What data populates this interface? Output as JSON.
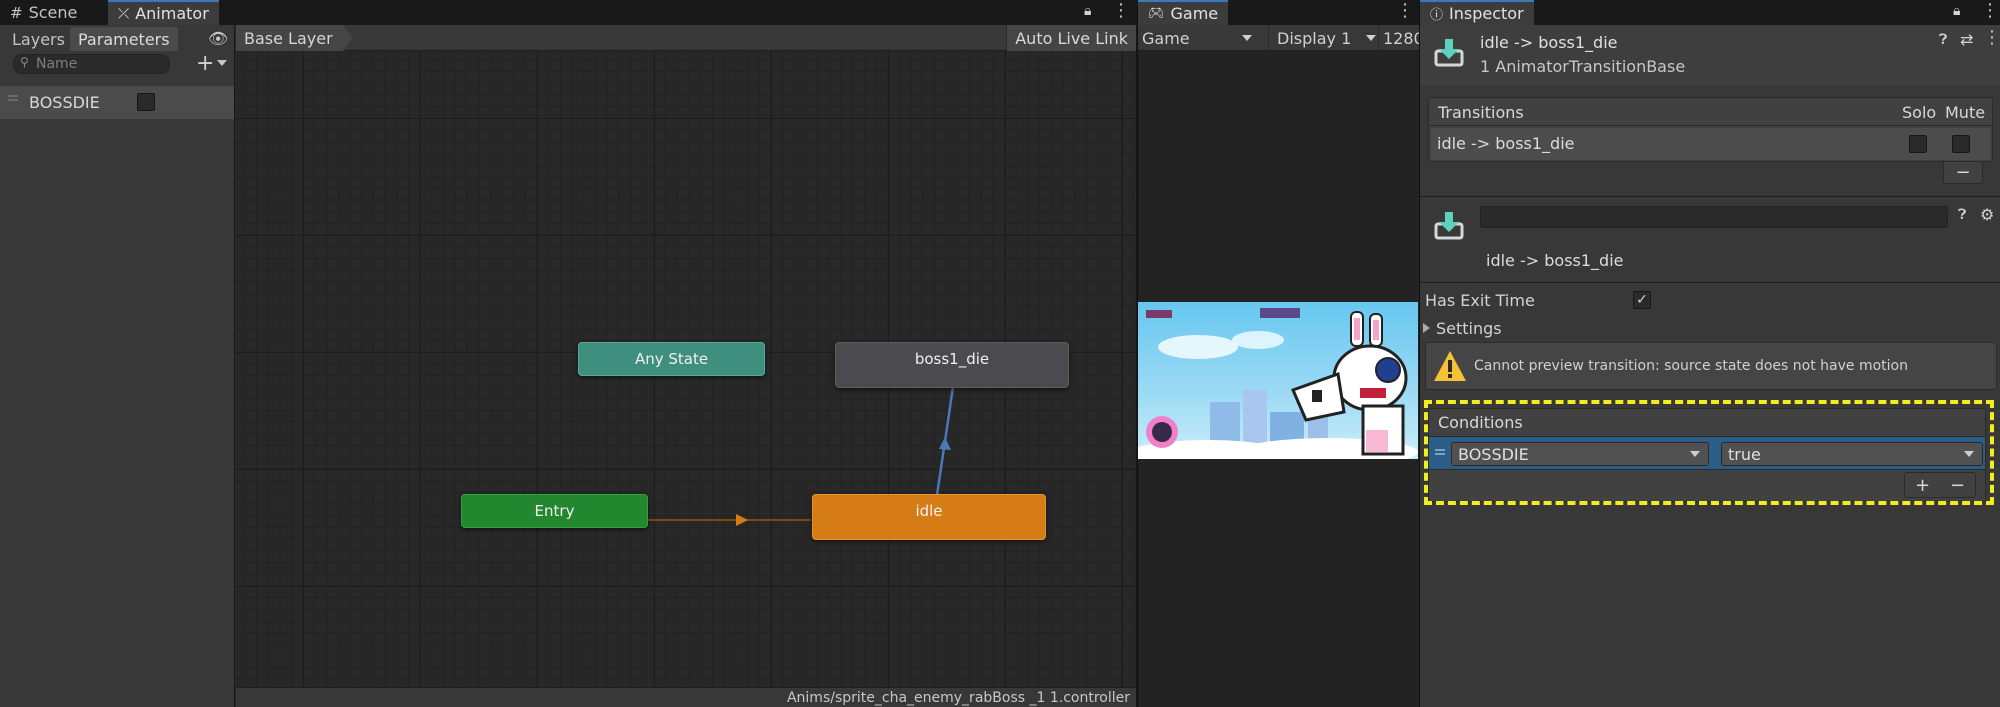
{
  "tabs": {
    "scene": "Scene",
    "animator": "Animator",
    "game": "Game",
    "inspector": "Inspector"
  },
  "animator": {
    "subtabs": {
      "layers": "Layers",
      "parameters": "Parameters"
    },
    "search_placeholder": "Name",
    "parameters": [
      {
        "name": "BOSSDIE",
        "type": "bool",
        "value": false
      }
    ],
    "breadcrumb": "Base Layer",
    "auto_live_link": "Auto Live Link",
    "nodes": {
      "any_state": "Any State",
      "entry": "Entry",
      "idle": "idle",
      "boss1_die": "boss1_die"
    },
    "status_path": "Anims/sprite_cha_enemy_rabBoss _1 1.controller"
  },
  "game": {
    "mode": "Game",
    "display": "Display 1",
    "resolution": "1280:"
  },
  "inspector": {
    "title": "idle -> boss1_die",
    "subtitle": "1 AnimatorTransitionBase",
    "transitions_header": "Transitions",
    "solo": "Solo",
    "mute": "Mute",
    "transition_row": "idle -> boss1_die",
    "remove_symbol": "−",
    "transition_name_value": "",
    "transition_label": "idle -> boss1_die",
    "has_exit_time_label": "Has Exit Time",
    "has_exit_time": true,
    "settings_label": "Settings",
    "warning": "Cannot preview transition: source state does not have motion",
    "conditions_header": "Conditions",
    "condition": {
      "parameter": "BOSSDIE",
      "value": "true"
    },
    "add_symbol": "+"
  },
  "colors": {
    "entry": "#23872f",
    "any_state": "#3f8f7f",
    "idle": "#d57c16",
    "boss1_die": "#4b4b4f",
    "selection_dash": "#f1ee1f",
    "accent": "#3a79bb"
  }
}
